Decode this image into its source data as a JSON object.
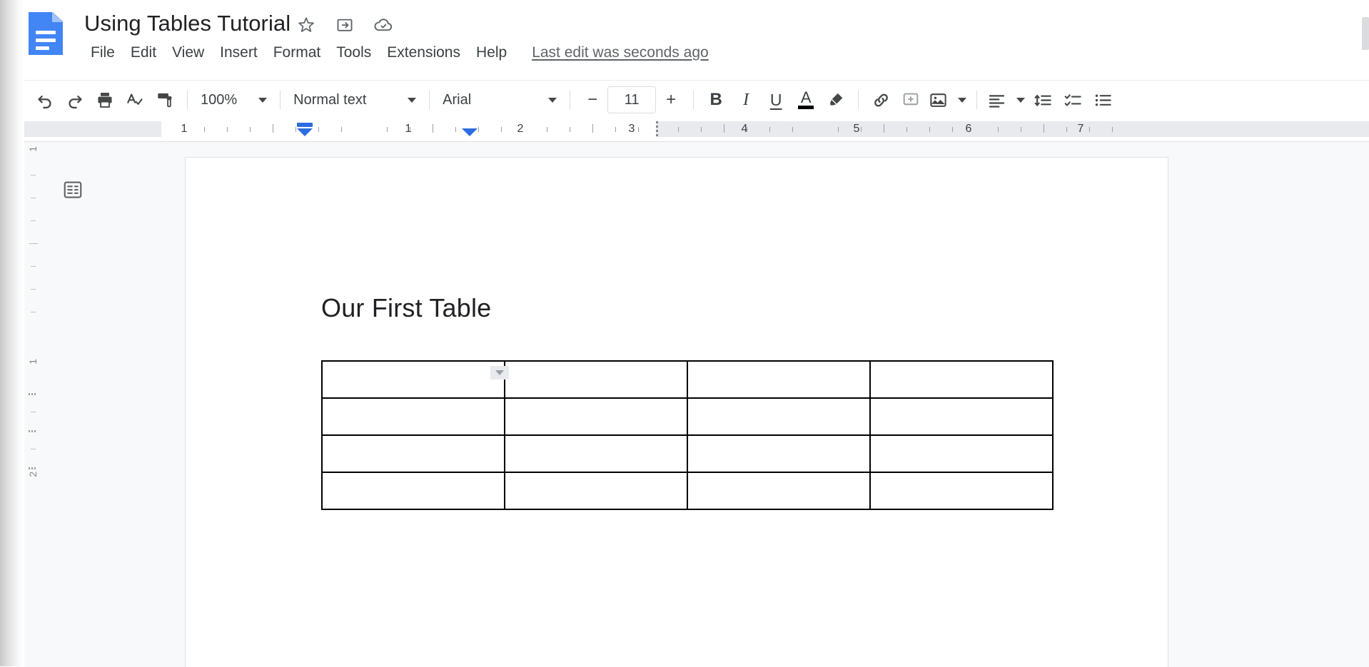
{
  "app": {
    "name": "Google Docs",
    "logo_icon": "google-docs-logo-icon",
    "accent_color": "#4285f4"
  },
  "header": {
    "doc_title": "Using Tables Tutorial",
    "title_icons": [
      {
        "name": "star-icon",
        "glyph": "☆",
        "tooltip": "Star"
      },
      {
        "name": "move-to-folder-icon",
        "glyph": "➡",
        "tooltip": "Move"
      },
      {
        "name": "cloud-saved-icon",
        "glyph": "☁",
        "tooltip": "Saved to Drive"
      }
    ],
    "menus": [
      {
        "label": "File"
      },
      {
        "label": "Edit"
      },
      {
        "label": "View"
      },
      {
        "label": "Insert"
      },
      {
        "label": "Format"
      },
      {
        "label": "Tools"
      },
      {
        "label": "Extensions"
      },
      {
        "label": "Help"
      }
    ],
    "last_edit": "Last edit was seconds ago"
  },
  "toolbar": {
    "undo_icon": "undo-icon",
    "redo_icon": "redo-icon",
    "print_icon": "print-icon",
    "spelling_icon": "spelling-check-icon",
    "paint_format_icon": "paint-format-icon",
    "zoom_value": "100%",
    "style_value": "Normal text",
    "font_value": "Arial",
    "font_size_decrease": "−",
    "font_size_value": "11",
    "font_size_increase": "+",
    "bold_label": "B",
    "italic_label": "I",
    "underline_label": "U",
    "text_color_label": "A",
    "text_color_swatch": "#000000",
    "highlight_icon": "highlight-pen-icon",
    "link_icon": "insert-link-icon",
    "comment_icon": "add-comment-icon",
    "image_icon": "insert-image-icon",
    "align_icon": "text-align-icon",
    "line_spacing_icon": "line-spacing-icon",
    "checklist_icon": "checklist-icon",
    "bulleted_list_icon": "bulleted-list-icon"
  },
  "ruler": {
    "numbers": [
      "1",
      "1",
      "2",
      "3",
      "4",
      "5",
      "6",
      "7"
    ],
    "left_indent_marker": "left-indent-marker",
    "first_line_indent_marker": "first-line-indent-marker",
    "right_indent_marker": "right-indent-marker",
    "tab_stop_marker": "tab-stop-marker"
  },
  "vertical_ruler": {
    "numbers": [
      "1",
      "1",
      "2"
    ]
  },
  "sidebar": {
    "outline_icon": "document-outline-icon"
  },
  "document": {
    "heading": "Our First Table",
    "table": {
      "rows": 4,
      "cols": 4,
      "cells": [
        [
          "",
          "",
          "",
          ""
        ],
        [
          "",
          "",
          "",
          ""
        ],
        [
          "",
          "",
          "",
          ""
        ],
        [
          "",
          "",
          "",
          ""
        ]
      ],
      "cell_options_chip_icon": "cell-options-dropdown-icon"
    }
  }
}
